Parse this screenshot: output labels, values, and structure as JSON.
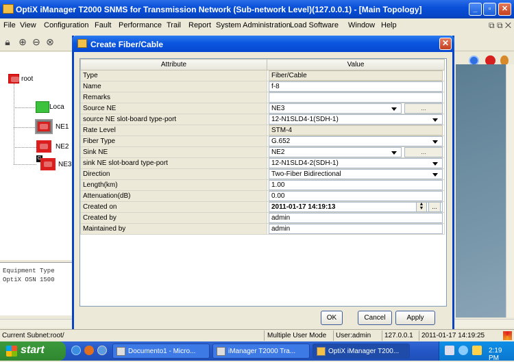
{
  "window": {
    "title": "OptiX iManager T2000 SNMS for Transmission Network (Sub-network Level)(127.0.0.1) - [Main Topology]"
  },
  "menu": [
    "File",
    "View",
    "Configuration",
    "Fault",
    "Performance",
    "Trail",
    "Report",
    "System Administration",
    "Load Software",
    "Window",
    "Help"
  ],
  "tree": {
    "root": "root",
    "local": "Loca",
    "ne1": "NE1",
    "ne2": "NE2",
    "ne3": "NE3"
  },
  "left_info": {
    "line1": "Equipment Type",
    "line2": "OptiX OSN 1500"
  },
  "dialog": {
    "title": "Create Fiber/Cable",
    "col_attribute": "Attribute",
    "col_value": "Value",
    "rows": [
      {
        "attr": "Type",
        "value": "Fiber/Cable"
      },
      {
        "attr": "Name",
        "value": "f-8"
      },
      {
        "attr": "Remarks",
        "value": ""
      },
      {
        "attr": "Source NE",
        "value": "NE3",
        "dots": "..."
      },
      {
        "attr": "source NE slot-board type-port",
        "value": "12-N1SLD4-1(SDH-1)"
      },
      {
        "attr": "Rate Level",
        "value": "STM-4"
      },
      {
        "attr": "Fiber Type",
        "value": "G.652"
      },
      {
        "attr": "Sink NE",
        "value": "NE2",
        "dots": "..."
      },
      {
        "attr": "sink NE slot-board type-port",
        "value": "12-N1SLD4-2(SDH-1)"
      },
      {
        "attr": "Direction",
        "value": "Two-Fiber Bidirectional"
      },
      {
        "attr": "Length(km)",
        "value": "1.00"
      },
      {
        "attr": "Attenuation(dB)",
        "value": "0.00"
      },
      {
        "attr": "Created on",
        "value": "2011-01-17 14:19:13",
        "dots": "..."
      },
      {
        "attr": "Created by",
        "value": "admin"
      },
      {
        "attr": "Maintained by",
        "value": "admin"
      }
    ],
    "buttons": {
      "ok": "OK",
      "cancel": "Cancel",
      "apply": "Apply"
    }
  },
  "status": {
    "subnet": "Current Subnet:root/",
    "mode": "Multiple User Mode",
    "user": "User:admin",
    "ip": "127.0.0.1",
    "time": "2011-01-17 14:19:25"
  },
  "taskbar": {
    "start": "start",
    "tasks": [
      "Documento1 - Micro...",
      "iManager T2000 Tra...",
      "OptiX iManager T200..."
    ],
    "clock": "2:19 PM"
  },
  "colors": {
    "titlebar": "#0a50d8",
    "ne_icon": "#d91e1e",
    "taskbar": "#2456c6",
    "start": "#3c9a3c"
  }
}
